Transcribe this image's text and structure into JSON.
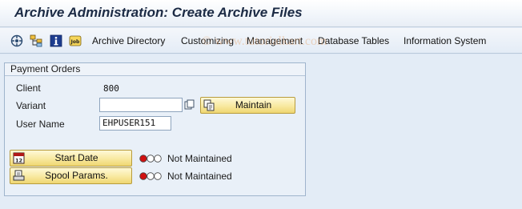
{
  "window": {
    "title": "Archive Administration: Create Archive Files"
  },
  "toolbar": {
    "icons": [
      "execute-icon",
      "hierarchy-icon",
      "info-icon",
      "job-icon"
    ],
    "menus": [
      {
        "label": "Archive Directory"
      },
      {
        "label": "Customizing"
      },
      {
        "label": "Management"
      },
      {
        "label": "Database Tables"
      },
      {
        "label": "Information System"
      }
    ]
  },
  "watermark": {
    "text": "© www.tutorialkart.com"
  },
  "group": {
    "title": "Payment Orders",
    "client": {
      "label": "Client",
      "value": "800"
    },
    "variant": {
      "label": "Variant",
      "value": "",
      "maintain_label": "Maintain"
    },
    "user": {
      "label": "User Name",
      "value": "EHPUSER151"
    },
    "start_date": {
      "label": "Start Date",
      "status": "Not Maintained"
    },
    "spool": {
      "label": "Spool Params.",
      "status": "Not Maintained"
    }
  },
  "colors": {
    "accent": "#f8e9a0",
    "status_red": "#d01010",
    "title": "#1b2a44"
  }
}
